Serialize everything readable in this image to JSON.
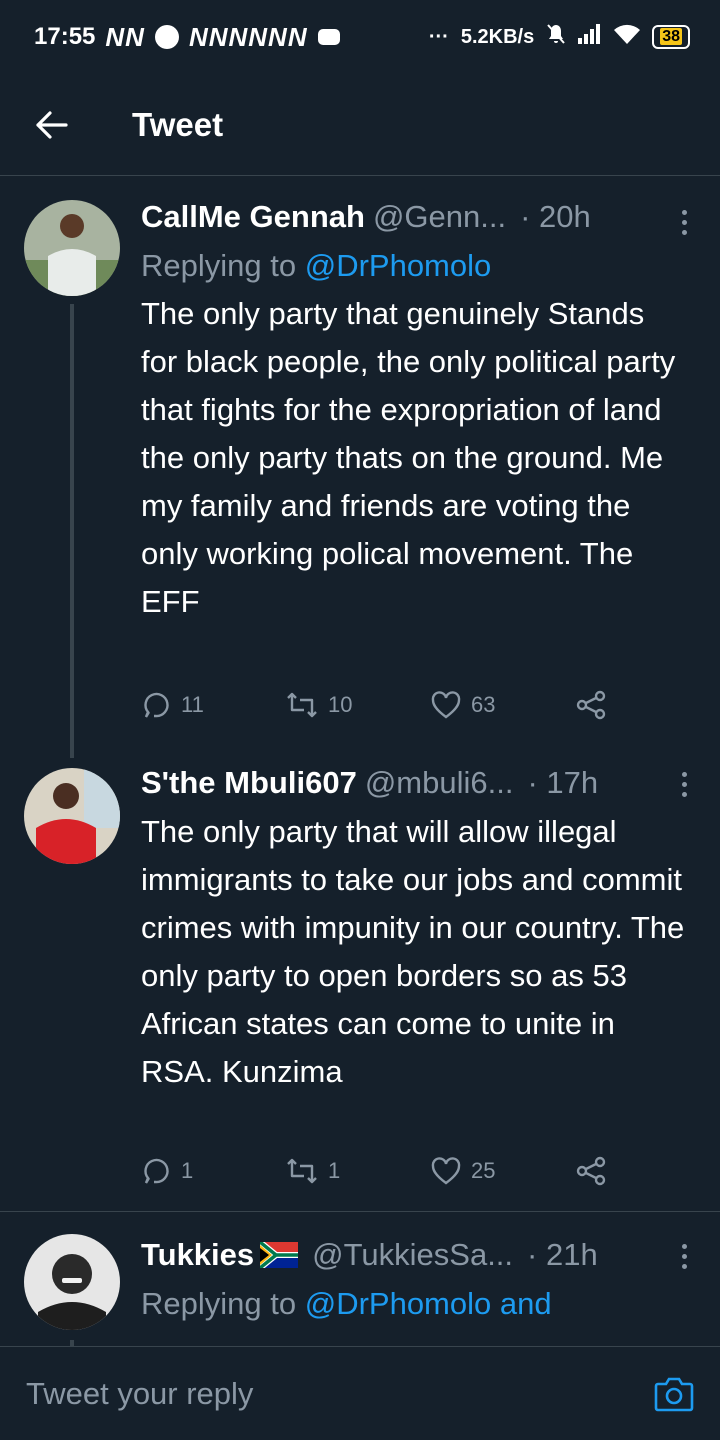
{
  "status_bar": {
    "time": "17:55",
    "carrier_glyphs": "NN",
    "carrier_glyphs_2": "NNNNNN",
    "net_speed": "5.2KB/s",
    "battery": "38"
  },
  "header": {
    "title": "Tweet"
  },
  "tweets": [
    {
      "name": "CallMe Gennah",
      "handle": "@Genn...",
      "time": "· 20h",
      "reply_prefix": "Replying to ",
      "reply_mention": "@DrPhomolo",
      "text": "The only party that genuinely Stands for black people, the only political party that fights for the expropriation of land the only party thats on the ground. Me my family and friends are voting the only working polical movement. The EFF",
      "replies": "11",
      "retweets": "10",
      "likes": "63"
    },
    {
      "name": "S'the Mbuli607",
      "handle": "@mbuli6...",
      "time": "· 17h",
      "text": "The only party that will allow illegal immigrants to take our jobs and commit crimes with impunity in our country. The only party to open borders so as 53 African states can come to unite in RSA. Kunzima",
      "replies": "1",
      "retweets": "1",
      "likes": "25"
    },
    {
      "name": "Tukkies",
      "handle": "@TukkiesSa...",
      "time": "· 21h",
      "reply_prefix": "Replying to ",
      "reply_mention": "@DrPhomolo and"
    }
  ],
  "reply_bar": {
    "placeholder": "Tweet your reply"
  },
  "colors": {
    "background": "#15202b",
    "accent": "#1d9bf0",
    "muted": "#8b98a5",
    "divider": "#38444d"
  }
}
